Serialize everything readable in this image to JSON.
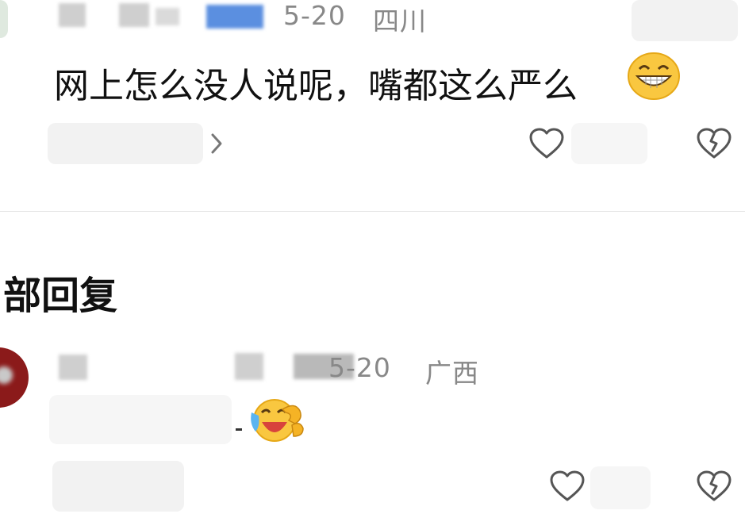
{
  "comment1": {
    "date": "5-20",
    "location": "四川",
    "text": "网上怎么没人说呢，嘴都这么严么"
  },
  "section": {
    "title": "部回复"
  },
  "reply1": {
    "date": "5-20",
    "location": "广西"
  },
  "icons": {
    "grin": "grinning-face-emoji",
    "laugh": "laughing-crying-emoji",
    "like": "heart-outline-icon",
    "dislike": "broken-heart-icon",
    "more": "chevron-right-icon"
  }
}
